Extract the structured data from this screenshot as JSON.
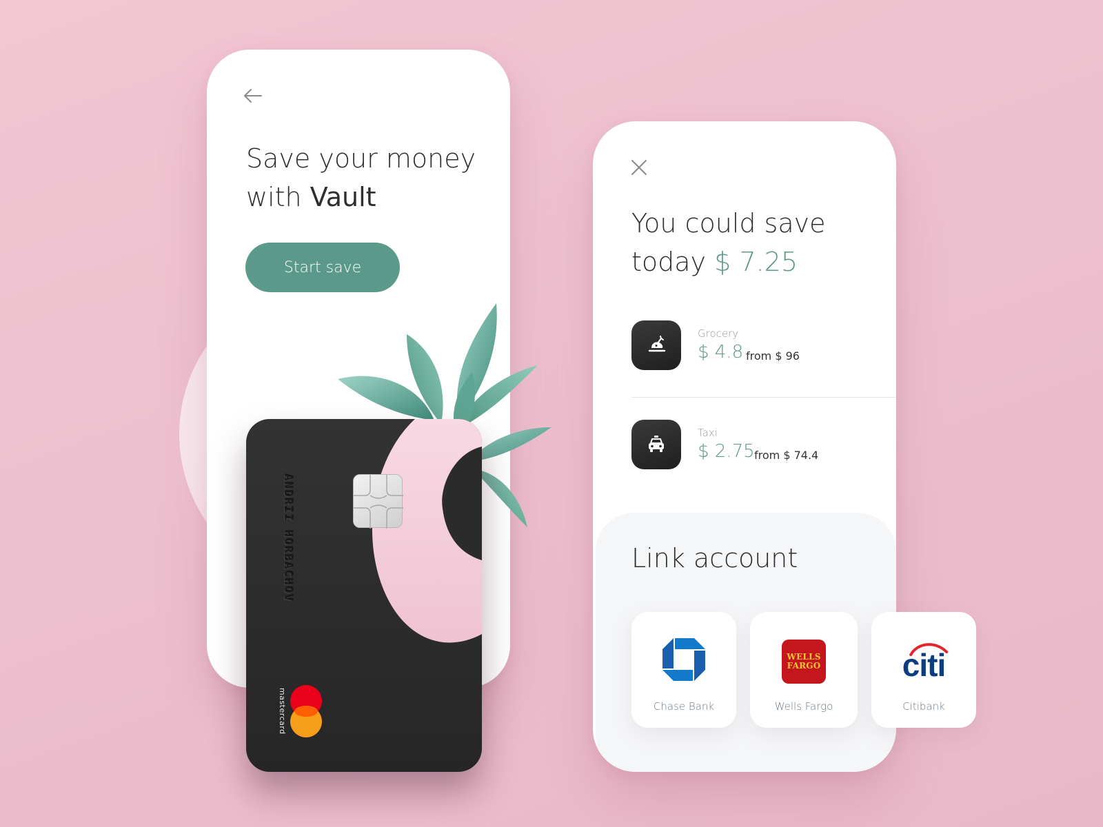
{
  "left_screen": {
    "title_line1": "Save your money",
    "title_line2_prefix": "with ",
    "title_brand": "Vault",
    "start_button": "Start save"
  },
  "card": {
    "holder_name": "ANDRII HORBACHOV",
    "network": "mastercard"
  },
  "right_screen": {
    "title_line1": "You could save",
    "title_line2_prefix": "today ",
    "save_amount": "$ 7.25",
    "savings": [
      {
        "category": "Grocery",
        "amount": "$ 4.8",
        "from": "from $ 96",
        "icon": "grocery-icon"
      },
      {
        "category": "Taxi",
        "amount": "$ 2.75",
        "from": "from $ 74.4",
        "icon": "taxi-icon"
      }
    ],
    "link_title": "Link account",
    "banks": [
      {
        "name": "Chase Bank",
        "logo": "chase-logo"
      },
      {
        "name": "Wells Fargo",
        "logo": "wells-fargo-logo",
        "logo_line1": "WELLS",
        "logo_line2": "FARGO"
      },
      {
        "name": "Citibank",
        "logo": "citi-logo",
        "logo_text": "citi"
      }
    ]
  },
  "colors": {
    "accent": "#5b9a8b",
    "background": "#ecbfce",
    "card": "#2b2b2b",
    "card_pink": "#f4cfdc"
  }
}
